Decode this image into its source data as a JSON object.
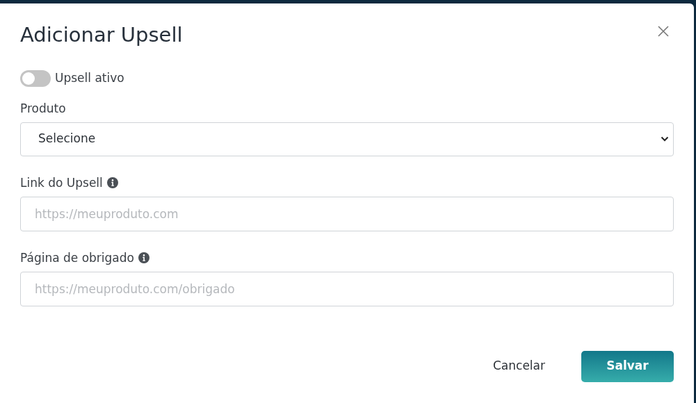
{
  "dialog": {
    "title": "Adicionar Upsell",
    "toggle": {
      "label": "Upsell ativo",
      "on": false
    },
    "fields": [
      {
        "kind": "select",
        "label": "Produto",
        "value": "Selecione",
        "info": false
      },
      {
        "kind": "input",
        "label": "Link do Upsell",
        "placeholder": "https://meuproduto.com",
        "info": true
      },
      {
        "kind": "input",
        "label": "Página de obrigado",
        "placeholder": "https://meuproduto.com/obrigado",
        "info": true
      }
    ],
    "buttons": {
      "cancel": "Cancelar",
      "save": "Salvar"
    }
  }
}
